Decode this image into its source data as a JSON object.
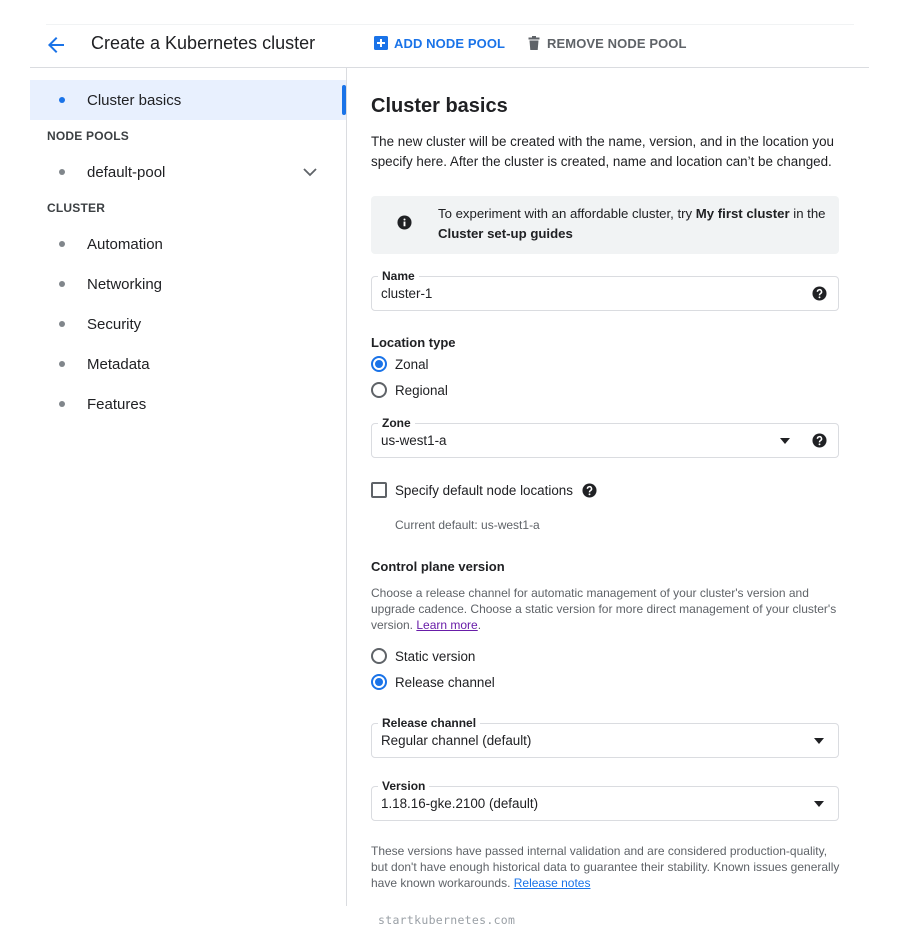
{
  "header": {
    "title": "Create a Kubernetes cluster",
    "back_icon": "arrow-back-icon",
    "add_node_pool_label": "ADD NODE POOL",
    "add_icon": "add-box-icon",
    "remove_node_pool_label": "REMOVE NODE POOL",
    "remove_icon": "trash-icon"
  },
  "sidebar": {
    "active_item": {
      "label": "Cluster basics"
    },
    "node_pools_heading": "NODE POOLS",
    "node_pools": [
      {
        "label": "default-pool",
        "expand_icon": "chevron-down-icon"
      }
    ],
    "cluster_heading": "CLUSTER",
    "cluster_items": [
      {
        "label": "Automation"
      },
      {
        "label": "Networking"
      },
      {
        "label": "Security"
      },
      {
        "label": "Metadata"
      },
      {
        "label": "Features"
      }
    ]
  },
  "main": {
    "title": "Cluster basics",
    "intro": "The new cluster will be created with the name, version, and in the location you specify here. After the cluster is created, name and location can’t be changed.",
    "info": {
      "icon": "info-icon",
      "text_before": "To experiment with an affordable cluster, try ",
      "bold1": "My first cluster",
      "text_middle": " in the ",
      "bold2": "Cluster set-up guides"
    },
    "name_field": {
      "label": "Name",
      "value": "cluster-1"
    },
    "location_type": {
      "heading": "Location type",
      "options": [
        {
          "label": "Zonal",
          "checked": true
        },
        {
          "label": "Regional",
          "checked": false
        }
      ]
    },
    "zone_field": {
      "label": "Zone",
      "value": "us-west1-a"
    },
    "node_locations": {
      "label": "Specify default node locations",
      "checked": false,
      "current_default": "Current default: us-west1-a"
    },
    "control_plane": {
      "heading": "Control plane version",
      "description": "Choose a release channel for automatic management of your cluster's version and upgrade cadence. Choose a static version for more direct management of your cluster's version. ",
      "learn_more": "Learn more",
      "options": [
        {
          "label": "Static version",
          "checked": false
        },
        {
          "label": "Release channel",
          "checked": true
        }
      ]
    },
    "release_channel_field": {
      "label": "Release channel",
      "value": "Regular channel (default)"
    },
    "version_field": {
      "label": "Version",
      "value": "1.18.16-gke.2100 (default)"
    },
    "version_note": "These versions have passed internal validation and are considered production-quality, but don't have enough historical data to guarantee their stability. Known issues generally have known workarounds. ",
    "release_notes": "Release notes"
  },
  "watermark": "startkubernetes.com",
  "colors": {
    "accent": "#1a73e8",
    "active_bg": "#e8f0fe",
    "info_bg": "#f1f3f4",
    "link_visited": "#681da8"
  }
}
